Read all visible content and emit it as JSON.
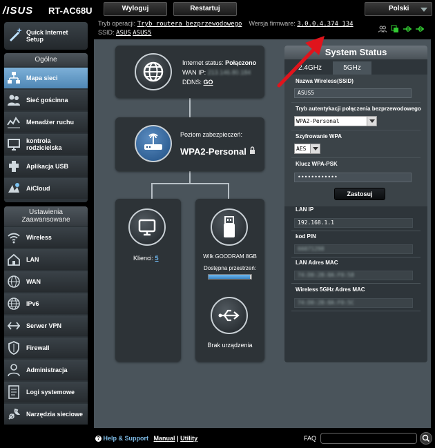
{
  "header": {
    "brand": "/ISUS",
    "model": "RT-AC68U",
    "logout_label": "Wyloguj",
    "restart_label": "Restartuj",
    "language": "Polski"
  },
  "info": {
    "op_mode_label": "Tryb operacji:",
    "op_mode_value": "Tryb routera bezprzewodowego",
    "firmware_label": "Wersja firmware:",
    "firmware_value": "3.0.0.4.374_134",
    "ssid_label": "SSID:",
    "ssid_1": "ASUS",
    "ssid_2": "ASUS5"
  },
  "sidebar": {
    "quick_setup": "Quick Internet Setup",
    "general_header": "Ogólne",
    "general_items": [
      {
        "label": "Mapa sieci",
        "icon": "network-map-icon"
      },
      {
        "label": "Sieć gościnna",
        "icon": "guest-network-icon"
      },
      {
        "label": "Menadżer ruchu",
        "icon": "traffic-manager-icon"
      },
      {
        "label": "kontrola rodzicielska",
        "icon": "parental-control-icon"
      },
      {
        "label": "Aplikacja USB",
        "icon": "usb-app-icon"
      },
      {
        "label": "AiCloud",
        "icon": "aicloud-icon"
      }
    ],
    "advanced_header": "Ustawienia Zaawansowane",
    "advanced_items": [
      {
        "label": "Wireless",
        "icon": "wireless-icon"
      },
      {
        "label": "LAN",
        "icon": "lan-icon"
      },
      {
        "label": "WAN",
        "icon": "wan-icon"
      },
      {
        "label": "IPv6",
        "icon": "ipv6-icon"
      },
      {
        "label": "Serwer VPN",
        "icon": "vpn-icon"
      },
      {
        "label": "Firewall",
        "icon": "firewall-icon"
      },
      {
        "label": "Administracja",
        "icon": "administration-icon"
      },
      {
        "label": "Logi systemowe",
        "icon": "system-log-icon"
      },
      {
        "label": "Narzędzia sieciowe",
        "icon": "network-tools-icon"
      }
    ]
  },
  "map": {
    "internet_status_label": "Internet status:",
    "internet_status_value": "Połączono",
    "wan_ip_label": "WAN IP:",
    "wan_ip_value": "213.146.80.184",
    "ddns_label": "DDNS:",
    "ddns_value": "GO",
    "security_label": "Poziom zabezpieczeń:",
    "security_value": "WPA2-Personal",
    "clients_label": "Klienci:",
    "clients_value": "5",
    "usb_name": "Wilk GOODRAM 8GB",
    "usb_space_label": "Dostępna przestrzeń:",
    "usb_space_fraction": 0.97,
    "no_device": "Brak urządzenia"
  },
  "system_status": {
    "title": "System Status",
    "tab_24": "2.4GHz",
    "tab_5": "5GHz",
    "ssid_label": "Nazwa Wireless(SSID)",
    "ssid_value": "ASUS5",
    "auth_label": "Tryb autentykacji połączenia bezprzewodowego",
    "auth_value": "WPA2-Personal",
    "enc_label": "Szyfrowanie WPA",
    "enc_value": "AES",
    "psk_label": "Klucz WPA-PSK",
    "psk_value": "••••••••••••",
    "apply_label": "Zastosuj",
    "lan_ip_label": "LAN IP",
    "lan_ip_value": "192.168.1.1",
    "pin_label": "kod PIN",
    "pin_value": "66071298",
    "lan_mac_label": "LAN Adres MAC",
    "lan_mac_value": "74:D0:2B:8A:F0:58",
    "wl5_mac_label": "Wireless 5GHz Adres MAC",
    "wl5_mac_value": "74:D0:2B:8A:F0:5C"
  },
  "footer": {
    "help_label": "Help & Support",
    "manual_label": "Manual",
    "sep": "|",
    "utility_label": "Utility",
    "faq_label": "FAQ"
  },
  "colors": {
    "accent_active": "#6fa3d0",
    "arrow": "#e0141c",
    "status_green": "#32c832"
  }
}
